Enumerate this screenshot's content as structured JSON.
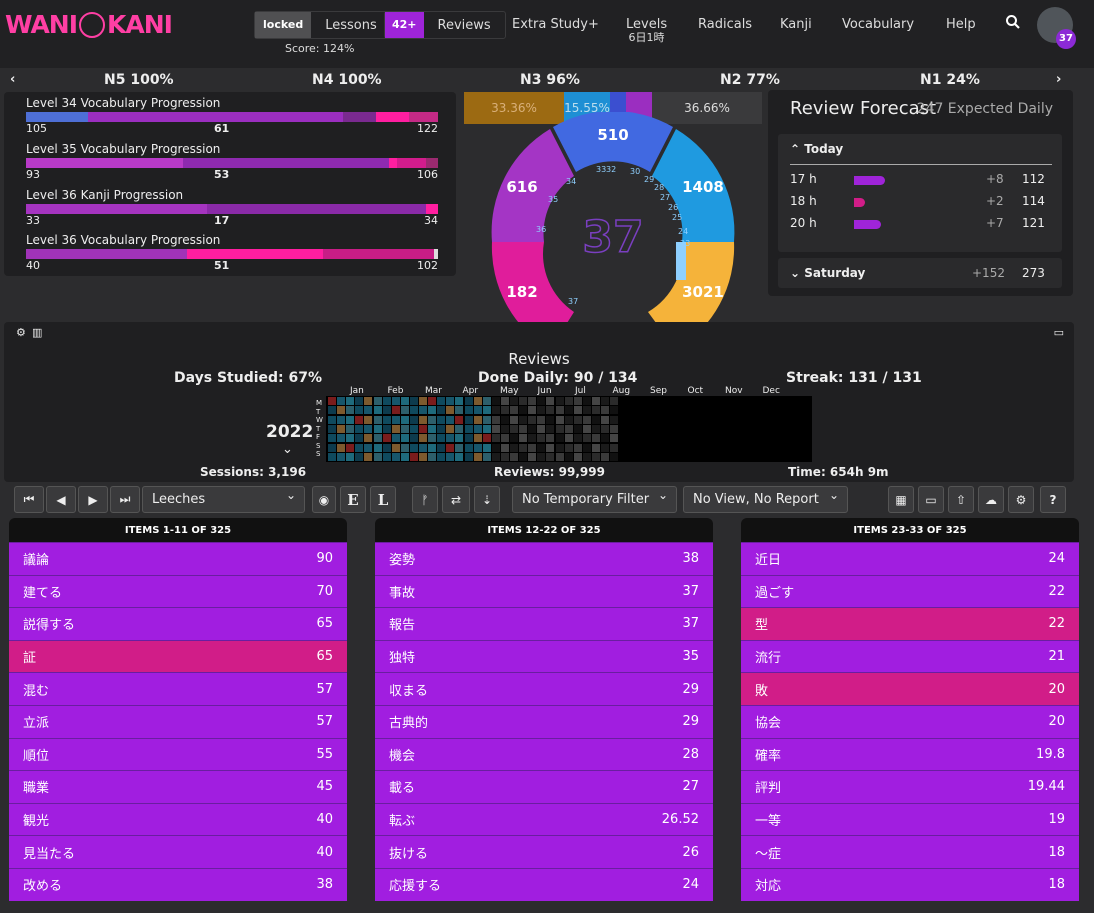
{
  "brand": {
    "name": "WANI KANI",
    "level": "37"
  },
  "topbar": {
    "locked_label": "locked",
    "lessons_label": "Lessons",
    "score": "Score: 124%",
    "reviews_count": "42+",
    "reviews_label": "Reviews",
    "extra_study": "Extra Study+",
    "levels_label": "Levels",
    "levels_sub": "6日1時",
    "radicals": "Radicals",
    "kanji": "Kanji",
    "vocabulary": "Vocabulary",
    "help": "Help"
  },
  "jlpt": {
    "n5": "N5 100%",
    "n4": "N4 100%",
    "n3": "N3 96%",
    "n2": "N2 77%",
    "n1": "N1 24%"
  },
  "progressions": [
    {
      "title": "Level 34 Vocabulary Progression",
      "left": "105",
      "mid": "61",
      "right": "122"
    },
    {
      "title": "Level 35 Vocabulary Progression",
      "left": "93",
      "mid": "53",
      "right": "106"
    },
    {
      "title": "Level 36 Kanji Progression",
      "left": "33",
      "mid": "17",
      "right": "34"
    },
    {
      "title": "Level 36 Vocabulary Progression",
      "left": "40",
      "mid": "51",
      "right": "102"
    }
  ],
  "srs": {
    "top_bar": [
      "33.36%",
      "15.55%",
      "36.66%"
    ],
    "center": "37",
    "apprentice": "616",
    "guru": "510",
    "master": "1408",
    "enlightened": "3021",
    "burned": "182",
    "ticks": [
      "34",
      "35",
      "36",
      "37",
      "33",
      "32",
      "30",
      "29",
      "28",
      "27",
      "26",
      "25",
      "24",
      "23",
      "22"
    ]
  },
  "forecast": {
    "title": "Review Forecast",
    "expected": "247 Expected Daily",
    "today": "Today",
    "rows": [
      {
        "hour": "17 h",
        "add": "+8",
        "total": "112",
        "frac": 0.35
      },
      {
        "hour": "18 h",
        "add": "+2",
        "total": "114",
        "frac": 0.12
      },
      {
        "hour": "20 h",
        "add": "+7",
        "total": "121",
        "frac": 0.3
      }
    ],
    "saturday": "Saturday",
    "sat_add": "+152",
    "sat_total": "273"
  },
  "stats": {
    "title": "Reviews",
    "days_studied": "Days Studied: 67%",
    "done_daily": "Done Daily: 90 / 134",
    "streak": "Streak: 131 / 131",
    "year": "2022",
    "months": [
      "Jan",
      "Feb",
      "Mar",
      "Apr",
      "May",
      "Jun",
      "Jul",
      "Aug",
      "Sep",
      "Oct",
      "Nov",
      "Dec"
    ],
    "weekdays": [
      "M",
      "T",
      "W",
      "T",
      "F",
      "S",
      "S"
    ],
    "sessions": "Sessions: 3,196",
    "reviews": "Reviews: 99,999",
    "time": "Time: 654h 9m"
  },
  "toolbar": {
    "filter1": "Leeches",
    "filter2": "No Temporary Filter",
    "filter3": "No View, No Report"
  },
  "columns": [
    {
      "header": "ITEMS 1-11 OF 325",
      "items": [
        [
          "議論",
          "90",
          "v"
        ],
        [
          "建てる",
          "70",
          "v"
        ],
        [
          "説得する",
          "65",
          "v"
        ],
        [
          "証",
          "65",
          "p"
        ],
        [
          "混む",
          "57",
          "v"
        ],
        [
          "立派",
          "57",
          "v"
        ],
        [
          "順位",
          "55",
          "v"
        ],
        [
          "職業",
          "45",
          "v"
        ],
        [
          "観光",
          "40",
          "v"
        ],
        [
          "見当たる",
          "40",
          "v"
        ],
        [
          "改める",
          "38",
          "v"
        ]
      ]
    },
    {
      "header": "ITEMS 12-22 OF 325",
      "items": [
        [
          "姿勢",
          "38",
          "v"
        ],
        [
          "事故",
          "37",
          "v"
        ],
        [
          "報告",
          "37",
          "v"
        ],
        [
          "独特",
          "35",
          "v"
        ],
        [
          "収まる",
          "29",
          "v"
        ],
        [
          "古典的",
          "29",
          "v"
        ],
        [
          "機会",
          "28",
          "v"
        ],
        [
          "載る",
          "27",
          "v"
        ],
        [
          "転ぶ",
          "26.52",
          "v"
        ],
        [
          "抜ける",
          "26",
          "v"
        ],
        [
          "応援する",
          "24",
          "v"
        ]
      ]
    },
    {
      "header": "ITEMS 23-33 OF 325",
      "items": [
        [
          "近日",
          "24",
          "v"
        ],
        [
          "過ごす",
          "22",
          "v"
        ],
        [
          "型",
          "22",
          "p"
        ],
        [
          "流行",
          "21",
          "v"
        ],
        [
          "敗",
          "20",
          "p"
        ],
        [
          "協会",
          "20",
          "v"
        ],
        [
          "確率",
          "19.8",
          "v"
        ],
        [
          "評判",
          "19.44",
          "v"
        ],
        [
          "一等",
          "19",
          "v"
        ],
        [
          "〜症",
          "18",
          "v"
        ],
        [
          "対応",
          "18",
          "v"
        ]
      ]
    }
  ]
}
